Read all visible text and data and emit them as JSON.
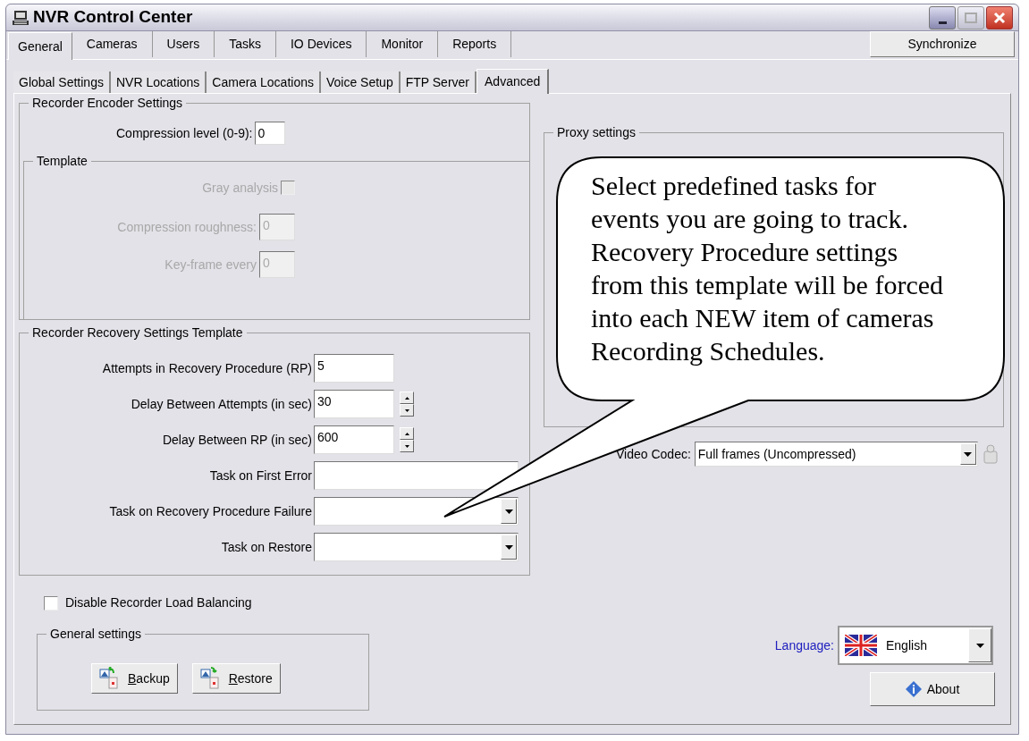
{
  "window": {
    "title": "NVR Control Center"
  },
  "main_tabs": [
    {
      "label": "General",
      "selected": true
    },
    {
      "label": "Cameras",
      "selected": false
    },
    {
      "label": "Users",
      "selected": false
    },
    {
      "label": "Tasks",
      "selected": false
    },
    {
      "label": "IO Devices",
      "selected": false
    },
    {
      "label": "Monitor",
      "selected": false
    },
    {
      "label": "Reports",
      "selected": false
    }
  ],
  "synchronize_button": "Synchronize",
  "sub_tabs": [
    {
      "label": "Global Settings",
      "selected": false
    },
    {
      "label": "NVR Locations",
      "selected": false
    },
    {
      "label": "Camera Locations",
      "selected": false
    },
    {
      "label": "Voice Setup",
      "selected": false
    },
    {
      "label": "FTP Server",
      "selected": false
    },
    {
      "label": "Advanced",
      "selected": true
    }
  ],
  "encoder_group": {
    "title": "Recorder Encoder Settings",
    "compression_label": "Compression level (0-9):",
    "compression_value": "0",
    "template": {
      "title": "Template",
      "items": [
        {
          "kind": "checkbox",
          "label": "Gray analysis",
          "checked": false,
          "disabled": true
        },
        {
          "kind": "text",
          "label": "Compression roughness:",
          "value": "0",
          "disabled": true
        },
        {
          "kind": "text",
          "label": "Key-frame every",
          "value": "0",
          "disabled": true
        }
      ]
    }
  },
  "recovery_group": {
    "title": "Recorder Recovery Settings Template",
    "rows": [
      {
        "kind": "text",
        "label": "Attempts in Recovery Procedure (RP)",
        "value": "5"
      },
      {
        "kind": "spinner",
        "label": "Delay Between Attempts (in sec)",
        "value": "30"
      },
      {
        "kind": "spinner",
        "label": "Delay Between RP (in sec)",
        "value": "600"
      },
      {
        "kind": "field",
        "label": "Task on First Error"
      },
      {
        "kind": "combo",
        "label": "Task on Recovery Procedure Failure"
      },
      {
        "kind": "combo",
        "label": "Task on Restore"
      }
    ]
  },
  "load_balancing": {
    "label": "Disable Recorder Load Balancing",
    "checked": false
  },
  "general_settings": {
    "title": "General settings",
    "buttons": [
      {
        "label": "Backup",
        "kind": "backup"
      },
      {
        "label": "Restore",
        "kind": "restore"
      }
    ]
  },
  "proxy_group": {
    "title": "Proxy settings"
  },
  "video_codec": {
    "label": "Video Codec:",
    "value": "Full frames (Uncompressed)"
  },
  "language": {
    "label": "Language:",
    "value": "English"
  },
  "about_button": "About",
  "callout": {
    "lines": [
      "Select predefined tasks for",
      "events you are going to track.",
      "Recovery Procedure settings",
      "from this template will be forced",
      "into each NEW item of cameras",
      "Recording Schedules."
    ]
  }
}
